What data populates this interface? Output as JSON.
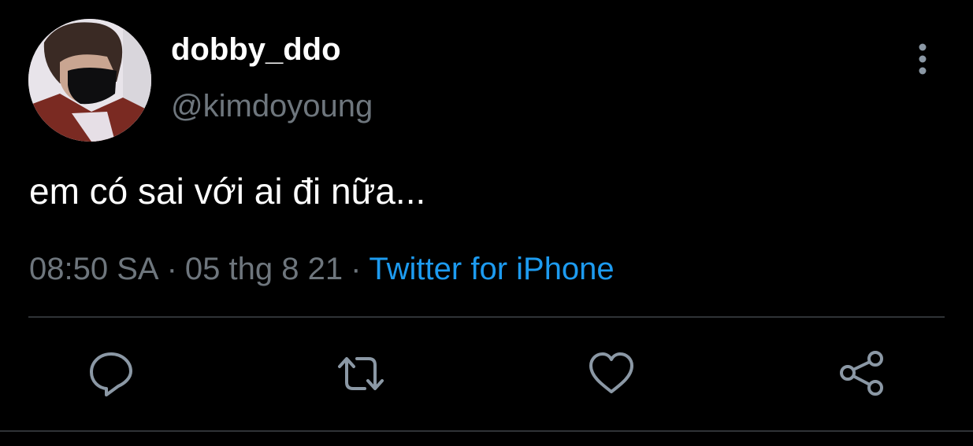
{
  "tweet": {
    "display_name": "dobby_ddo",
    "handle": "@kimdoyoung",
    "text": "em có sai với ai đi nữa...",
    "time": "08:50 SA",
    "separator": "·",
    "date": "05 thg 8 21",
    "source": "Twitter for iPhone"
  },
  "icons": {
    "avatar": "avatar",
    "more": "more-vertical-icon",
    "reply": "reply-icon",
    "retweet": "retweet-icon",
    "like": "heart-icon",
    "share": "share-icon"
  },
  "colors": {
    "background": "#000000",
    "text": "#ffffff",
    "secondary_text": "#6e767d",
    "link": "#1d9bf0",
    "divider": "#2f3336",
    "icon": "#8b98a5"
  }
}
